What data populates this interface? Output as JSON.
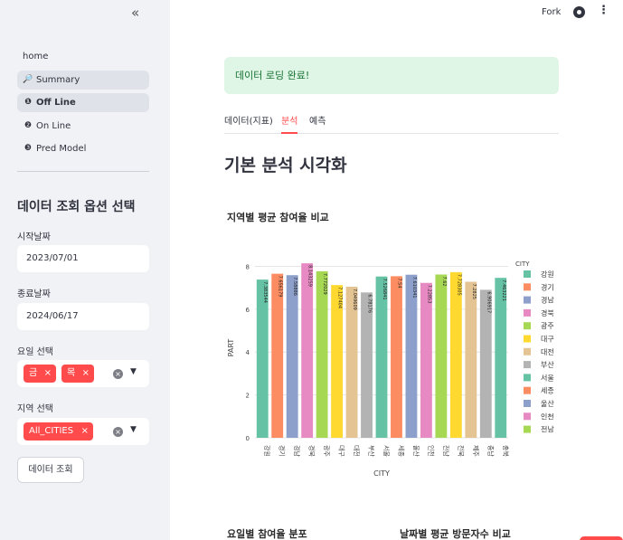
{
  "sidebar": {
    "collapse_icon": "double-chevron-left-icon",
    "nav": [
      {
        "label": "home",
        "icon": ""
      },
      {
        "label": "Summary",
        "icon": "🔎"
      },
      {
        "label": "Off Line",
        "icon": "❶"
      },
      {
        "label": "On Line",
        "icon": "❷"
      },
      {
        "label": "Pred Model",
        "icon": "❸"
      }
    ],
    "title": "데이터 조회 옵션 선택",
    "start_label": "시작날짜",
    "start_value": "2023/07/01",
    "end_label": "종료날짜",
    "end_value": "2024/06/17",
    "day_label": "요일 선택",
    "day_tags": [
      "금",
      "목"
    ],
    "region_label": "지역 선택",
    "region_tags": [
      "All_CITIES"
    ],
    "query_button": "데이터 조회"
  },
  "header": {
    "fork": "Fork"
  },
  "main": {
    "alert": "데이터 로딩 완료!",
    "tabs": [
      "데이터(지표)",
      "분석",
      "예측"
    ],
    "heading": "기본 분석 시각화",
    "sub1": "요일별 참여율 분포",
    "sub2": "날짜별 평균 방문자수 비교"
  },
  "chart_data": {
    "type": "bar",
    "title": "지역별 평균 참여율 비교",
    "xlabel": "CITY",
    "ylabel": "PART",
    "legend_title": "CITY",
    "ylim": [
      0,
      8.4
    ],
    "yticks": [
      0,
      2,
      4,
      6,
      8
    ],
    "categories": [
      "강원",
      "경기",
      "경남",
      "경북",
      "광주",
      "대구",
      "대전",
      "부산",
      "서울",
      "세종",
      "울산",
      "인천",
      "전남",
      "전북",
      "제주",
      "충남",
      "충북"
    ],
    "values": [
      7.383544,
      7.656179,
      7.58886,
      8.143259,
      7.772029,
      7.127404,
      7.049609,
      6.78176,
      7.526841,
      7.54,
      7.610341,
      7.22853,
      7.62,
      7.728305,
      7.2825,
      6.906917,
      7.463221
    ],
    "value_labels": [
      "7.383544",
      "7.656179",
      "7.58886",
      "8.143259",
      "7.772029",
      "7.127404",
      "7.049609",
      "6.78176",
      "7.526841",
      "7.54",
      "7.610341",
      "7.22853",
      "7.62",
      "7.728305",
      "7.2825",
      "6.906917",
      "7.463221"
    ],
    "colors": [
      "#66c2a5",
      "#fc8d62",
      "#8da0cb",
      "#e78ac3",
      "#a6d854",
      "#ffd92f",
      "#e5c494",
      "#b3b3b3",
      "#66c2a5",
      "#fc8d62",
      "#8da0cb",
      "#e78ac3",
      "#a6d854",
      "#ffd92f",
      "#e5c494",
      "#b3b3b3",
      "#66c2a5"
    ],
    "legend": [
      {
        "name": "강원",
        "color": "#66c2a5"
      },
      {
        "name": "경기",
        "color": "#fc8d62"
      },
      {
        "name": "경남",
        "color": "#8da0cb"
      },
      {
        "name": "경북",
        "color": "#e78ac3"
      },
      {
        "name": "광주",
        "color": "#a6d854"
      },
      {
        "name": "대구",
        "color": "#ffd92f"
      },
      {
        "name": "대전",
        "color": "#e5c494"
      },
      {
        "name": "부산",
        "color": "#b3b3b3"
      },
      {
        "name": "서울",
        "color": "#66c2a5"
      },
      {
        "name": "세종",
        "color": "#fc8d62"
      },
      {
        "name": "울산",
        "color": "#8da0cb"
      },
      {
        "name": "인천",
        "color": "#e78ac3"
      },
      {
        "name": "전남",
        "color": "#a6d854"
      }
    ]
  }
}
